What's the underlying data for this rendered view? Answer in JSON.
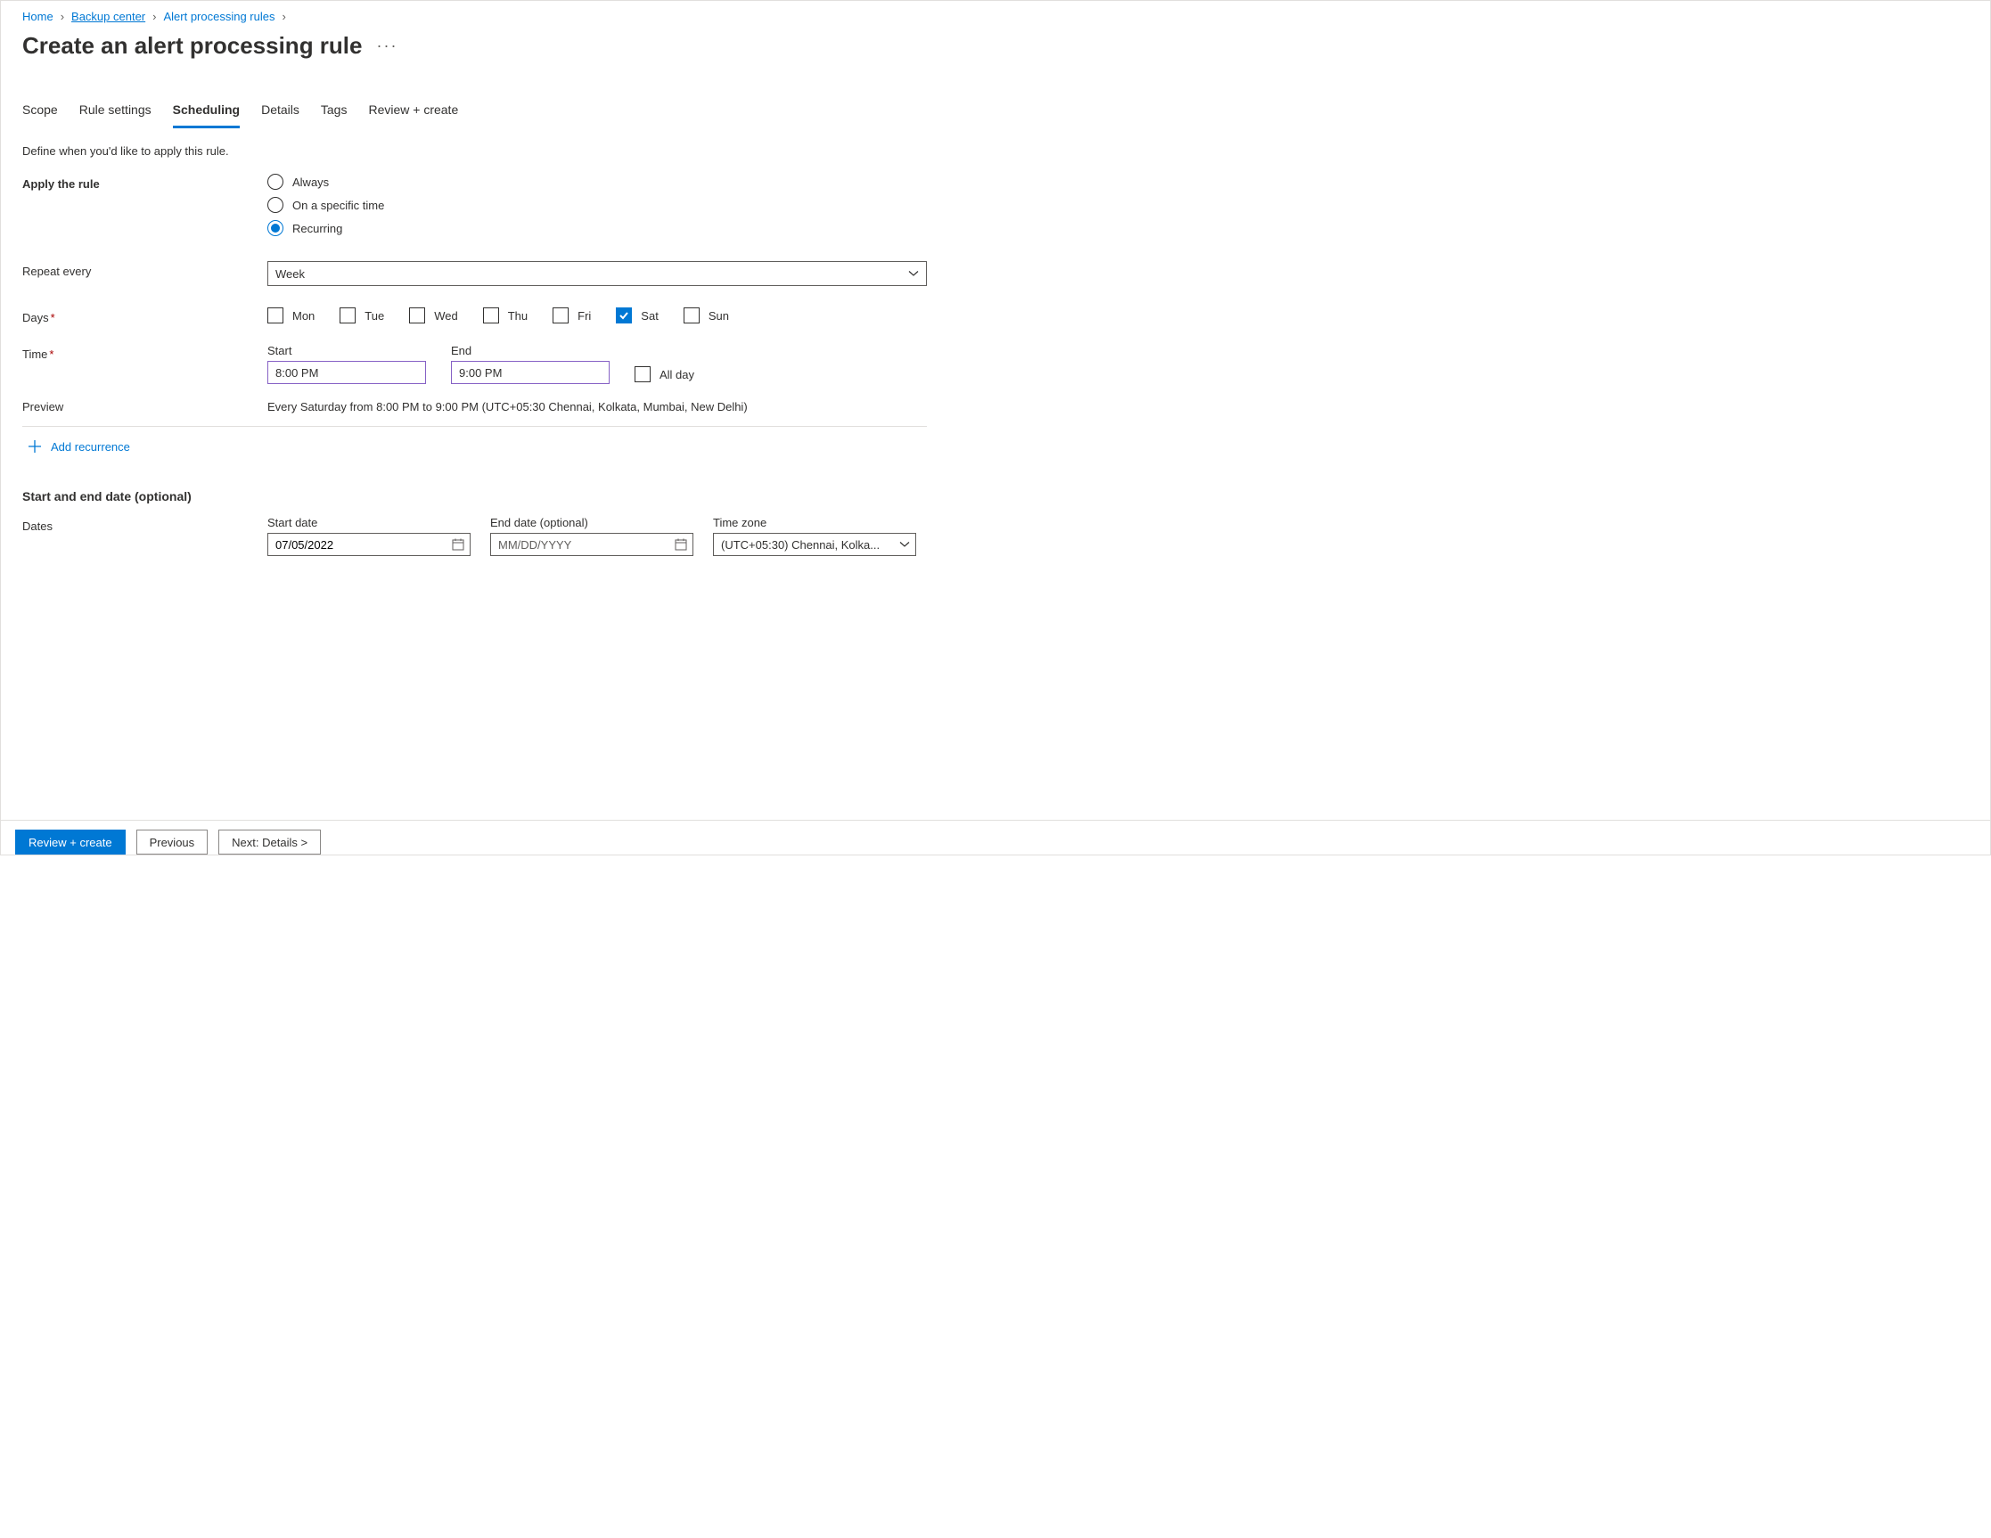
{
  "breadcrumb": {
    "items": [
      {
        "label": "Home"
      },
      {
        "label": "Backup center"
      },
      {
        "label": "Alert processing rules"
      }
    ]
  },
  "page": {
    "title": "Create an alert processing rule"
  },
  "tabs": [
    {
      "label": "Scope",
      "active": false
    },
    {
      "label": "Rule settings",
      "active": false
    },
    {
      "label": "Scheduling",
      "active": true
    },
    {
      "label": "Details",
      "active": false
    },
    {
      "label": "Tags",
      "active": false
    },
    {
      "label": "Review + create",
      "active": false
    }
  ],
  "description": "Define when you'd like to apply this rule.",
  "apply_rule": {
    "label": "Apply the rule",
    "options": [
      {
        "label": "Always",
        "selected": false
      },
      {
        "label": "On a specific time",
        "selected": false
      },
      {
        "label": "Recurring",
        "selected": true
      }
    ]
  },
  "repeat": {
    "label": "Repeat every",
    "value": "Week"
  },
  "days": {
    "label": "Days",
    "items": [
      {
        "label": "Mon",
        "checked": false
      },
      {
        "label": "Tue",
        "checked": false
      },
      {
        "label": "Wed",
        "checked": false
      },
      {
        "label": "Thu",
        "checked": false
      },
      {
        "label": "Fri",
        "checked": false
      },
      {
        "label": "Sat",
        "checked": true
      },
      {
        "label": "Sun",
        "checked": false
      }
    ]
  },
  "time": {
    "label": "Time",
    "start_label": "Start",
    "start_value": "8:00 PM",
    "end_label": "End",
    "end_value": "9:00 PM",
    "all_day_label": "All day",
    "all_day_checked": false
  },
  "preview": {
    "label": "Preview",
    "text": "Every Saturday from 8:00 PM to 9:00 PM (UTC+05:30 Chennai, Kolkata, Mumbai, New Delhi)"
  },
  "add_recurrence_label": "Add recurrence",
  "optional_section": {
    "title": "Start and end date (optional)",
    "dates_label": "Dates",
    "start_date_label": "Start date",
    "start_date_value": "07/05/2022",
    "end_date_label": "End date (optional)",
    "end_date_placeholder": "MM/DD/YYYY",
    "end_date_value": "",
    "tz_label": "Time zone",
    "tz_value": "(UTC+05:30) Chennai, Kolka..."
  },
  "footer": {
    "review_create": "Review + create",
    "previous": "Previous",
    "next": "Next: Details >"
  }
}
